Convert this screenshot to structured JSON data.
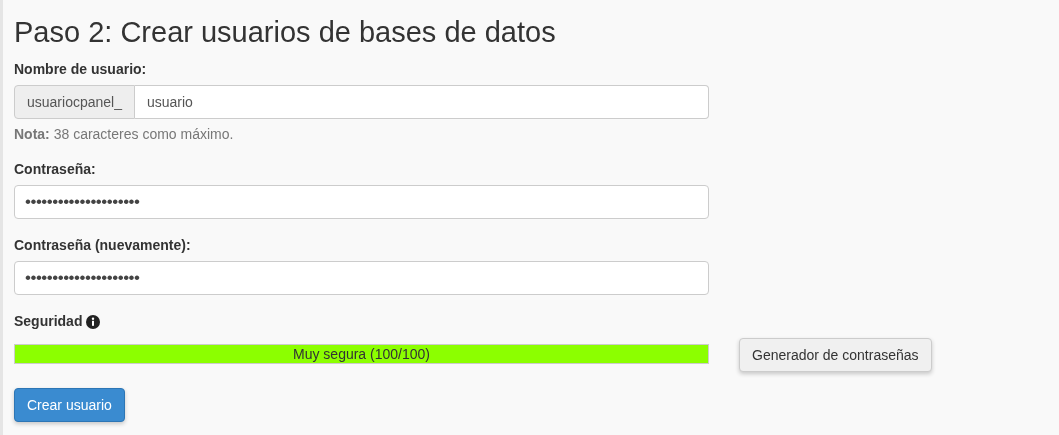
{
  "title": "Paso 2: Crear usuarios de bases de datos",
  "username": {
    "label": "Nombre de usuario:",
    "prefix": "usuariocpanel_",
    "value": "usuario",
    "note_label": "Nota:",
    "note": "38 caracteres como máximo."
  },
  "password": {
    "label": "Contraseña:",
    "value": "•••••••••••••••••••••"
  },
  "password_again": {
    "label": "Contraseña (nuevamente):",
    "value": "•••••••••••••••••••••"
  },
  "security": {
    "label": "Seguridad",
    "level": 1,
    "reading": "Muy segura (100/100)",
    "color": "#8cff00"
  },
  "generator_button": "Generador de contraseñas",
  "submit_button": "Crear usuario"
}
